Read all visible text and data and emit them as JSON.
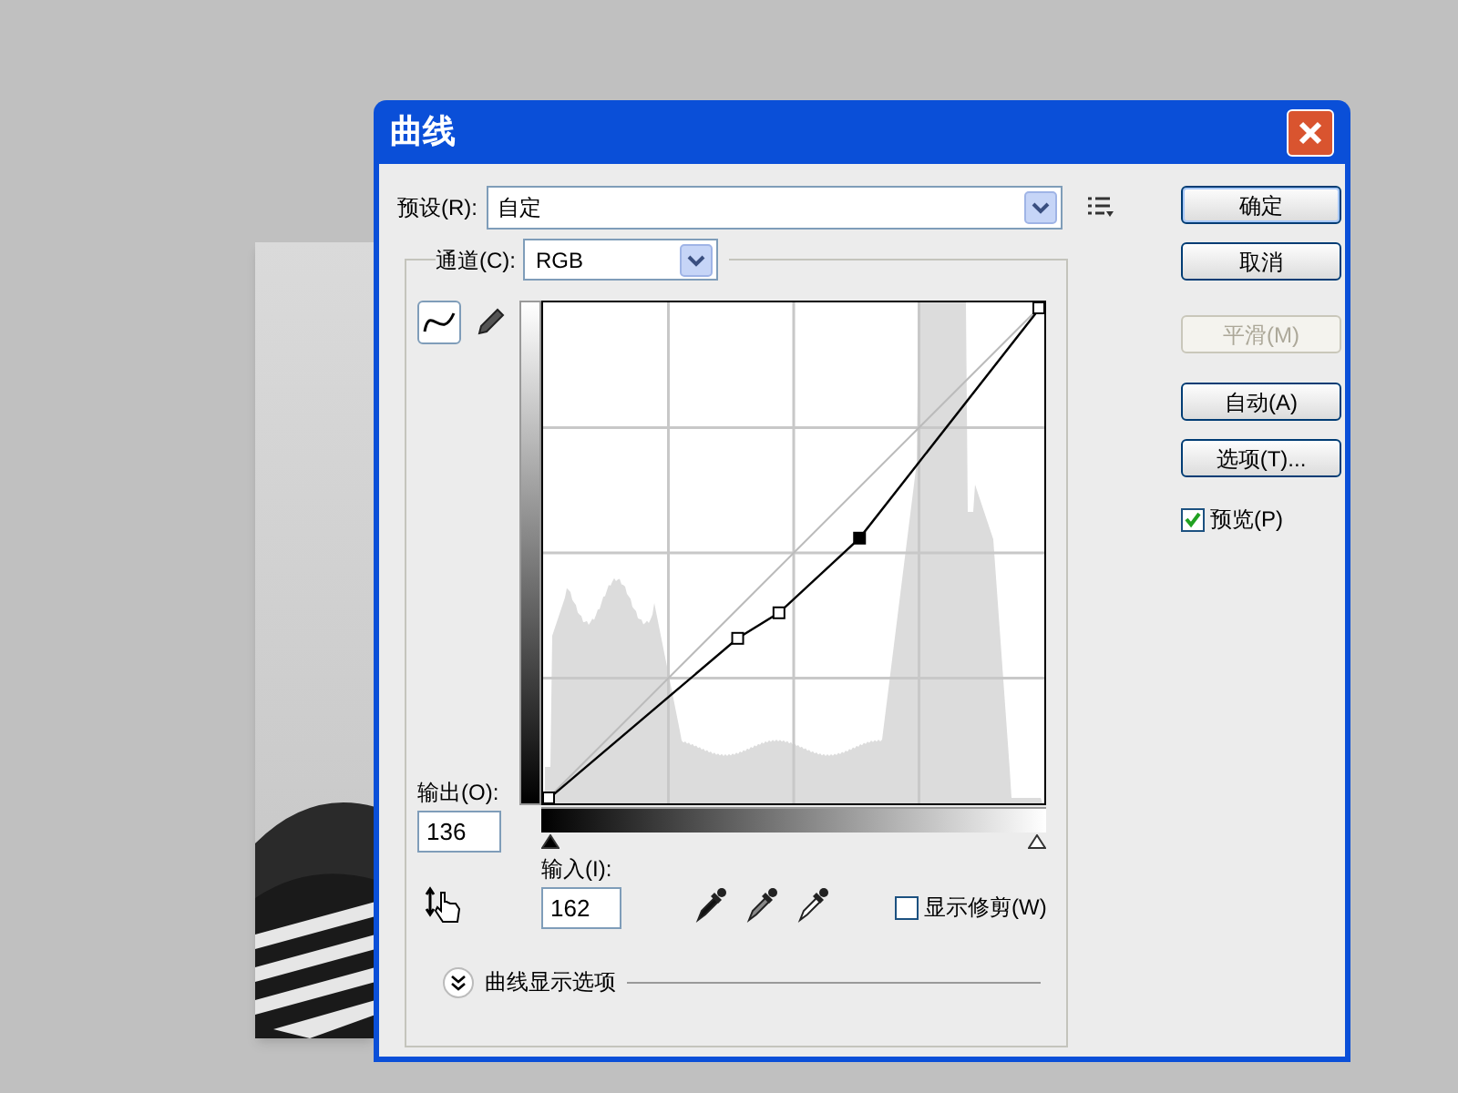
{
  "window": {
    "title": "曲线"
  },
  "preset": {
    "label": "预设(R):",
    "value": "自定"
  },
  "channel": {
    "label": "通道(C):",
    "value": "RGB"
  },
  "tools": [
    {
      "kind": "curve",
      "selected": true
    },
    {
      "kind": "pencil",
      "selected": false
    }
  ],
  "control_points": [
    {
      "selected": false
    },
    {
      "selected": false
    },
    {
      "selected": false
    },
    {
      "selected": true
    },
    {
      "selected": false
    }
  ],
  "output": {
    "label": "输出(O):",
    "value": "136"
  },
  "input_sliders": [
    {
      "level": 0
    },
    {
      "level": 1
    }
  ],
  "input": {
    "label": "输入(I):",
    "value": "162"
  },
  "show_clipping": {
    "label": "显示修剪(W)",
    "checked": false
  },
  "curve_display_options": {
    "label": "曲线显示选项"
  },
  "buttons": [
    {
      "label": "确定",
      "disabled": false,
      "default": true
    },
    {
      "label": "取消",
      "disabled": false,
      "default": false
    },
    {
      "label": "平滑(M)",
      "disabled": true,
      "default": false
    },
    {
      "label": "自动(A)",
      "disabled": false,
      "default": false
    },
    {
      "label": "选项(T)...",
      "disabled": false,
      "default": false
    }
  ],
  "preview": {
    "label": "预览(P)",
    "checked": true
  }
}
